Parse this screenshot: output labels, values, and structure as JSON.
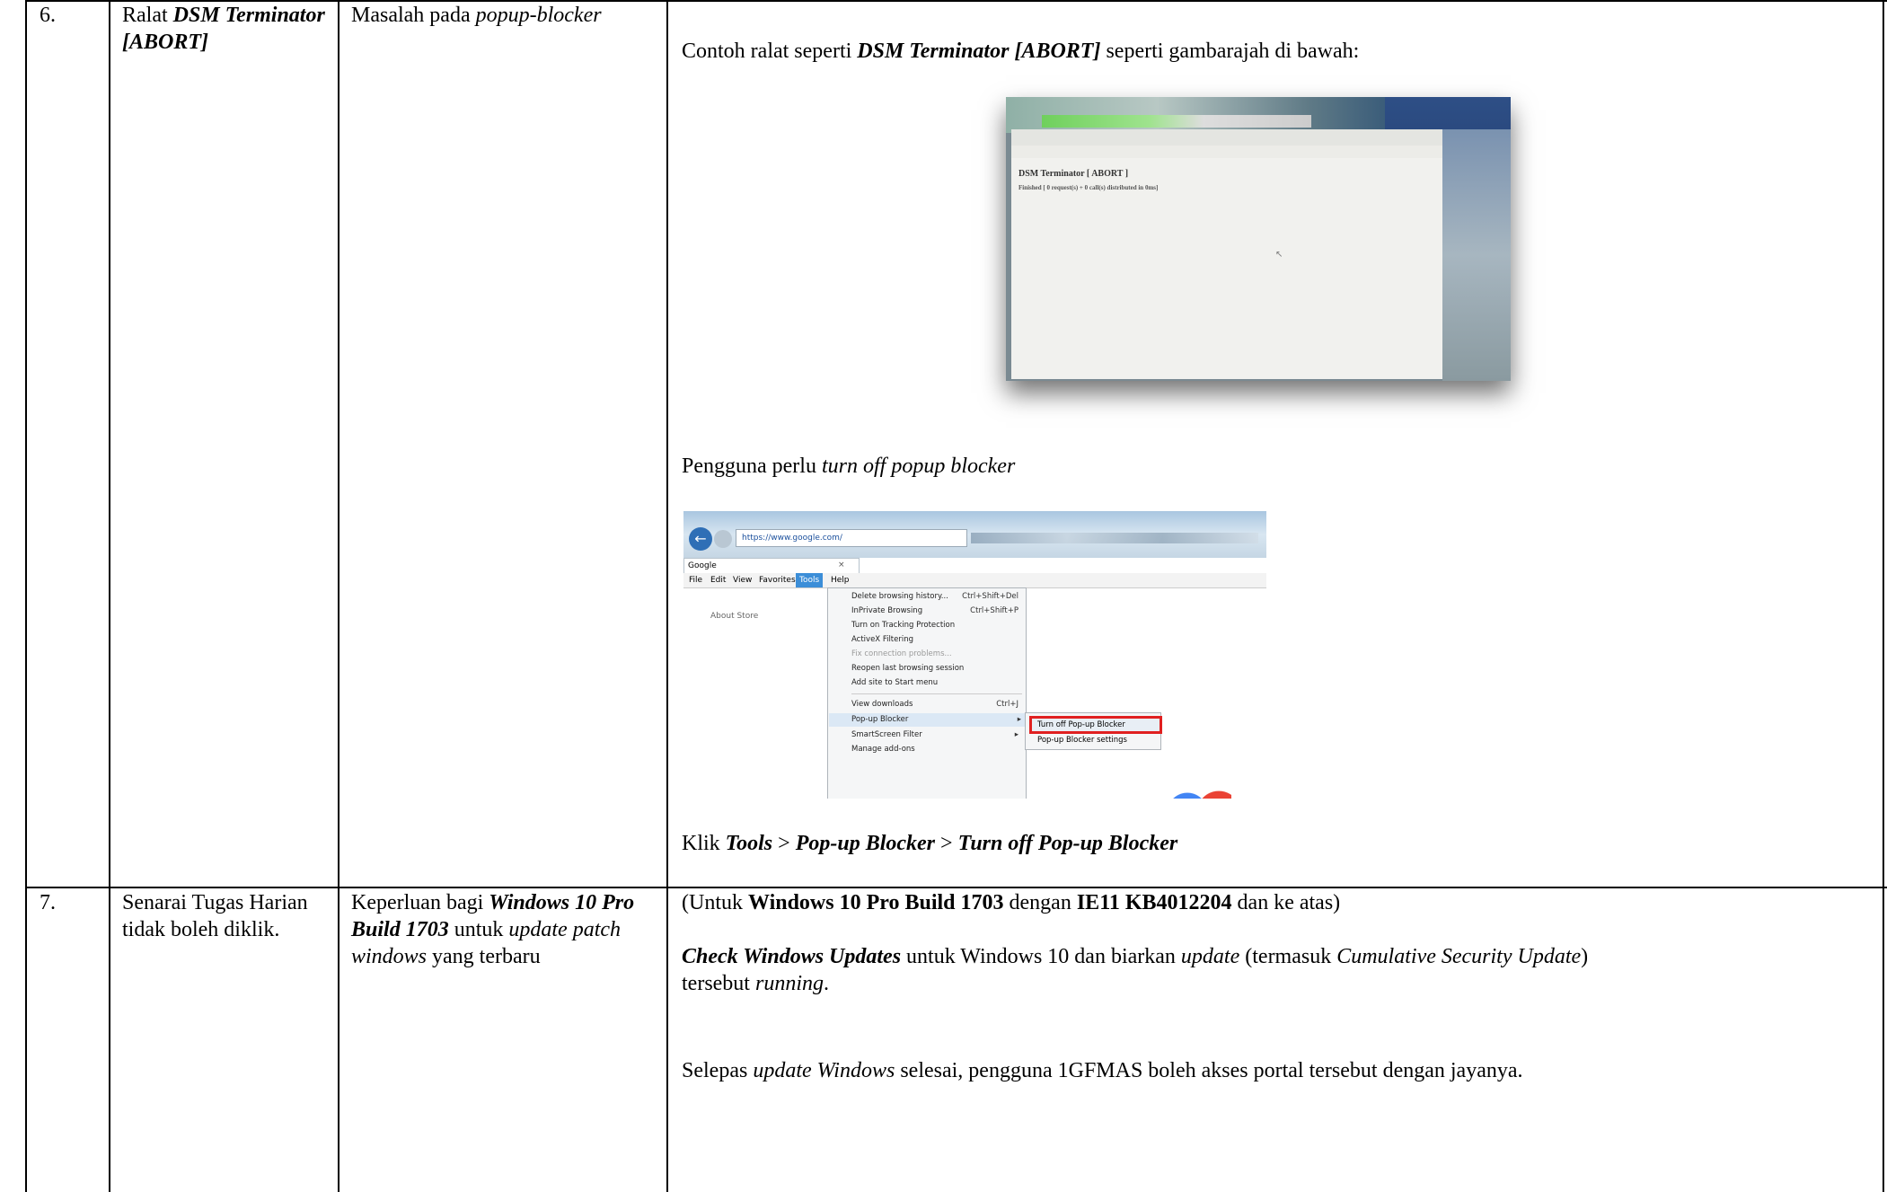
{
  "rows": [
    {
      "no": "6.",
      "title_plain": "Ralat ",
      "title_bold": "DSM Terminator [ABORT]",
      "desc_plain": "Masalah pada ",
      "desc_italic": "popup-blocker",
      "content": {
        "intro_plain": "Contoh ralat seperti ",
        "intro_bold": "DSM Terminator [ABORT]",
        "intro_tail": " seperti gambarajah di bawah:",
        "screenshot1": {
          "window_title": "DSM Terminator [ ABORT ]",
          "line": "Finished [ 0 request(s) + 0 call(s) distributed in 0ms]"
        },
        "turnoff_plain": "Pengguna perlu ",
        "turnoff_italic": "turn off  popup blocker",
        "screenshot2": {
          "address": "https://www.google.com/",
          "tab": "Google",
          "menu": [
            "File",
            "Edit",
            "View",
            "Favorites",
            "Tools",
            "Help"
          ],
          "page_links": "About   Store",
          "items": [
            {
              "label": "Delete browsing history...",
              "shortcut": "Ctrl+Shift+Del"
            },
            {
              "label": "InPrivate Browsing",
              "shortcut": "Ctrl+Shift+P"
            },
            {
              "label": "Turn on Tracking Protection",
              "shortcut": ""
            },
            {
              "label": "ActiveX Filtering",
              "shortcut": ""
            },
            {
              "label": "Fix connection problems...",
              "shortcut": ""
            },
            {
              "label": "Reopen last browsing session",
              "shortcut": ""
            },
            {
              "label": "Add site to Start menu",
              "shortcut": ""
            },
            {
              "label": "View downloads",
              "shortcut": "Ctrl+J"
            },
            {
              "label": "Pop-up Blocker",
              "shortcut": "▸"
            },
            {
              "label": "SmartScreen Filter",
              "shortcut": "▸"
            },
            {
              "label": "Manage add-ons",
              "shortcut": ""
            }
          ],
          "submenu": [
            "Turn off Pop-up Blocker",
            "Pop-up Blocker settings"
          ]
        },
        "klik_plain": "Klik ",
        "klik_path1": "Tools",
        "klik_sep": " > ",
        "klik_path2": "Pop-up Blocker",
        "klik_path3": "Turn off Pop-up Blocker"
      }
    },
    {
      "no": "7.",
      "title": "Senarai Tugas Harian tidak boleh diklik.",
      "desc_plain": "Keperluan bagi ",
      "desc_bold": "Windows 10 Pro Build 1703",
      "desc_plain2": " untuk ",
      "desc_italic": "update patch windows",
      "desc_tail": " yang terbaru",
      "content": {
        "p1_a": "(Untuk ",
        "p1_b": "Windows 10 Pro Build 1703",
        "p1_c": " dengan ",
        "p1_d": "IE11 KB4012204",
        "p1_e": " dan ke atas)",
        "p2_a": "Check Windows Updates",
        "p2_b": " untuk Windows 10 dan biarkan ",
        "p2_c": "update",
        "p2_d": " (termasuk ",
        "p2_e": "Cumulative Security Update",
        "p2_f": ")",
        "p2_g": "tersebut ",
        "p2_h": "running",
        "p2_i": ".",
        "p3_a": "Selepas ",
        "p3_b": "update Windows",
        "p3_c": " selesai, pengguna 1GFMAS boleh akses portal tersebut dengan jayanya."
      }
    }
  ]
}
